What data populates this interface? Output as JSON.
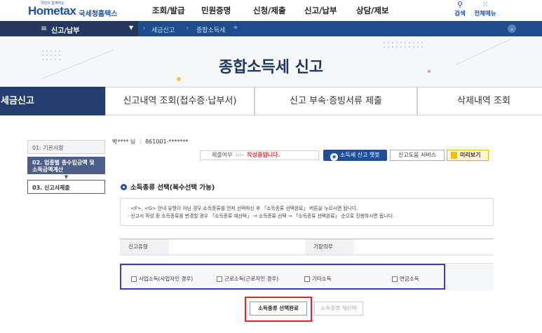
{
  "header": {
    "logo_tagline": "국민이 함께하는",
    "logo_text": "Hometax",
    "logo_agency": "국세청홈택스",
    "menu": [
      "조회/발급",
      "민원증명",
      "신청/제출",
      "신고/납부",
      "상담/제보"
    ],
    "utilities": [
      {
        "icon": "search-icon",
        "label": "검색"
      },
      {
        "icon": "grid-menu-icon",
        "label": "전체메뉴"
      }
    ]
  },
  "breadcrumb": {
    "section": "신고/납부",
    "items": [
      "세금신고",
      "종합소득세"
    ]
  },
  "page": {
    "title": "종합소득세 신고"
  },
  "tabs": [
    "세금신고",
    "신고내역 조회(접수증·납부서)",
    "신고 부속·증빙서류 제출",
    "삭제내역 조회"
  ],
  "steps": [
    "01. 기본사항",
    "02. 업종별 총수입금액 및 소득금액계산",
    "03. 신고서제출"
  ],
  "user": {
    "name": "박****",
    "suffix": "님",
    "id": "861001-*******"
  },
  "status": {
    "label": "제출여부",
    "arrows": "››››",
    "value": "작성중입니다."
  },
  "actions": {
    "chatbot": "소득세 신고 챗봇",
    "help": "신고도움 서비스",
    "preview": "미리보기"
  },
  "section": {
    "title": "소득종류 선택(복수선택 가능)"
  },
  "notice": [
    "· <F>, <G> 안내 유형이 아닌 경우 소득종류를 먼저 선택하신 후 「소득종류 선택완료」 버튼을 누르시면 됩니다.",
    "· 신고서 작성 중 소득종류를 변경할 경우 「소득종류 재선택」 → 소득종류 선택 → 「소득종류 선택완료」 순으로 진행하시면 됩니다."
  ],
  "grid": {
    "col1": "신고유형",
    "col2": "기장의무"
  },
  "income_types": [
    "사업소득(사업자인 경우)",
    "근로소득(근로자인 경우)",
    "기타소득",
    "연금소득"
  ],
  "buttons": {
    "complete": "소득종류 선택완료",
    "reselect": "소득종류 재선택"
  },
  "colors": {
    "nav_dark": "#24385f",
    "nav_blue": "#1e4c8d",
    "highlight_blue": "#3d3dbf",
    "highlight_red": "#e0242e",
    "status_red": "#e03b3b"
  }
}
